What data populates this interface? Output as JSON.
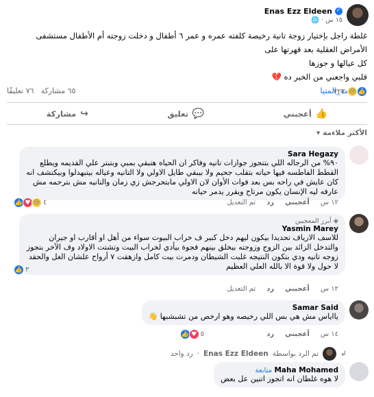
{
  "post": {
    "author": "Enas Ezz Eldeen",
    "time": "١٥ س",
    "privacy_icon": "globe-icon",
    "text_line1": "غلطة راجل بإختيار زوجة تانية رخيصة كلفته عمره و عمر ٦ أطفال و دخلت زوجته أم الأطفال مستشفى الأمراض العقلية بعد قهرتها على",
    "text_line2": "كل عيالها و جوزها",
    "text_line3": "قلبي واجعني من الخبر ده 💔",
    "hashtag": "#جريمة_المتيا",
    "reaction_count": "٧٢٢",
    "comments_count": "٧٦ تعليقًا",
    "shares_count": "٦٥ مشاركة"
  },
  "actions": {
    "like": "أعجبني",
    "comment": "تعليق",
    "share": "مشاركة"
  },
  "sort_label": "الأكثر ملاءمة",
  "comments": [
    {
      "name": "Sara Hegazy",
      "text": "٩٠% من الرجاله اللي بتتجوز جوازات تانيه وفاكر ان الحياه هتبقي بمبي وبتبتر علي القديمه ويطلع القطط الفاطسه فيها حياته بتقلب جحيم ولا بيبقي طايل الاولي ولا التانيه وعياله بيتبهدلوا وبيكتشف انه كان عايش في راحه بس بعد فوات الأوان لان الاولي مابتحرجش زي زمان والتانيه مش بترحمه مش عارفه ليه الإنسان يكون مرتاح ويقرر يدمر حياته",
      "time": "١٢ س",
      "like": "أعجبني",
      "reply": "رد",
      "edited": "تم التعديل",
      "reacts": "٤"
    },
    {
      "badge": "أبرز المعجبين",
      "name": "Yasmin Marey",
      "text": "للاسف الارياف تحديدا بيكون ليهم دخل كبير ف خراب البيوت سواء من أهل او أقارب او جيران والتدخل الزائد بين الزوج وزوجته بيخلق بينهم فجوة بيأدي لخراب البيت وتشتت الاولاد وف الآخر بتجوز زوجه تانيه ودي بتكون النتيجه غلبت الشيطان ودمرت بيت كامل وازهقت ٧ أرواح علشان الغل والحقد لا حول ولا قوة الا بالله العلي العظيم",
      "time": "١٢ س",
      "like": "أعجبني",
      "reply": "رد",
      "edited": "تم التعديل",
      "reacts": "٣"
    },
    {
      "name": "Samar Said",
      "text": "يااياس مش هي بس اللي رخيصه وهو ارخص من تشبشبها 👋",
      "time": "١٤ س",
      "like": "أعجبني",
      "reply": "رد",
      "reacts": "٥"
    }
  ],
  "reply_line": {
    "prefix": "تم الرد بواسطة",
    "author": "Enas Ezz Eldeen",
    "suffix": "رد واحد"
  },
  "last_comment": {
    "name": "Maha Mohamed",
    "follow": "متابعة",
    "text": "لا هوه غلطان انه اتجوز اتنين عل بعض"
  }
}
